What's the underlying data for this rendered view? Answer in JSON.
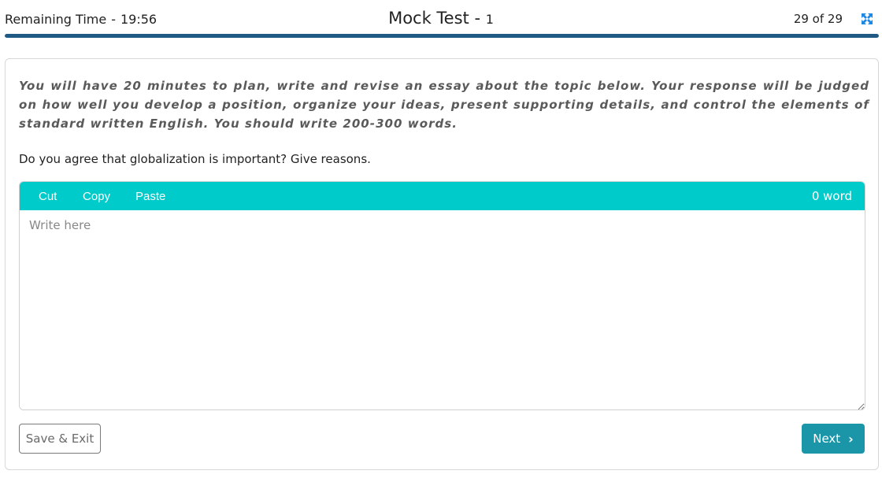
{
  "header": {
    "timer_label": "Remaining Time",
    "timer_separator": "-",
    "timer_value": "19:56",
    "title": "Mock Test -",
    "title_number": "1",
    "counter": "29 of 29",
    "progress_fraction": 1.0
  },
  "colors": {
    "progress": "#1f5a85",
    "toolbar": "#00cbcb",
    "next_button": "#1a96a8",
    "expand_icon": "#1e88e5"
  },
  "icons": {
    "expand": "expand-icon",
    "next": "chevron-right-icon"
  },
  "task": {
    "instructions": "You will have 20 minutes to plan, write and revise an essay about the topic below. Your response will be judged on how well you develop a position, organize your ideas, present supporting details, and control the elements of standard written English. You should write 200-300 words.",
    "question": "Do you agree that globalization is important? Give reasons."
  },
  "editor": {
    "toolbar": {
      "cut": "Cut",
      "copy": "Copy",
      "paste": "Paste"
    },
    "word_count": "0 word",
    "placeholder": "Write here",
    "value": ""
  },
  "footer": {
    "save_exit": "Save & Exit",
    "next": "Next"
  }
}
